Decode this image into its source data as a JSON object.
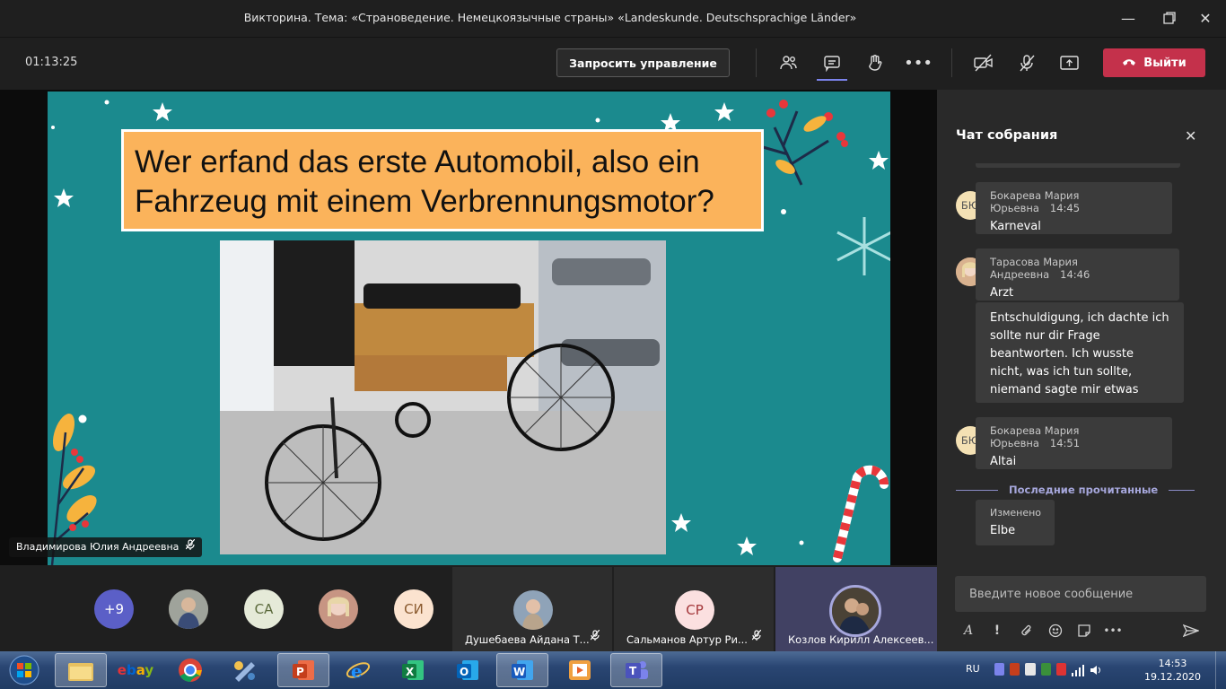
{
  "window": {
    "title": "Викторина. Тема: «Страноведение. Немецкоязычные страны» «Landeskunde. Deutschsprachige Länder»"
  },
  "toolbar": {
    "timer": "01:13:25",
    "request_control": "Запросить управление",
    "leave": "Выйти"
  },
  "slide": {
    "question": "Wer erfand das erste Automobil, also ein Fahrzeug mit einem Verbrennungsmotor?"
  },
  "speaker": {
    "name": "Владимирова Юлия Андреевна"
  },
  "participants": {
    "overflow": "+9",
    "avatars": [
      "СА",
      "СИ"
    ],
    "tiles": [
      {
        "name": "Душебаева Айдана Т..."
      },
      {
        "initials": "СР",
        "name": "Сальманов Артур Ри..."
      },
      {
        "name": "Козлов Кирилл Алексеев..."
      }
    ]
  },
  "chat": {
    "title": "Чат собрания",
    "messages": [
      {
        "initials": "БЮ",
        "author": "Бокарева Мария Юрьевна",
        "time": "14:45",
        "text": "Karneval"
      },
      {
        "author": "Тарасова Мария Андреевна",
        "time": "14:46",
        "text": "Arzt"
      },
      {
        "text": "Entschuldigung, ich dachte ich sollte nur dir Frage beantworten. Ich wusste nicht, was ich tun sollte, niemand sagte mir etwas"
      },
      {
        "initials": "БЮ",
        "author": "Бокарева Мария Юрьевна",
        "time": "14:51",
        "text": "Altai"
      }
    ],
    "last_read": "Последние прочитанные",
    "edited_label": "Изменено",
    "edited_text": "Elbe",
    "compose_placeholder": "Введите новое сообщение"
  },
  "taskbar": {
    "lang": "RU",
    "time": "14:53",
    "date": "19.12.2020",
    "apps": [
      "explorer",
      "ebay",
      "chrome",
      "paint",
      "powerpoint",
      "ie",
      "excel",
      "outlook",
      "word",
      "video",
      "teams"
    ]
  },
  "colors": {
    "slide_bg": "#1b8a8e",
    "question_bg": "#fbb35b",
    "leave": "#c4314b",
    "accent": "#7b83eb"
  }
}
